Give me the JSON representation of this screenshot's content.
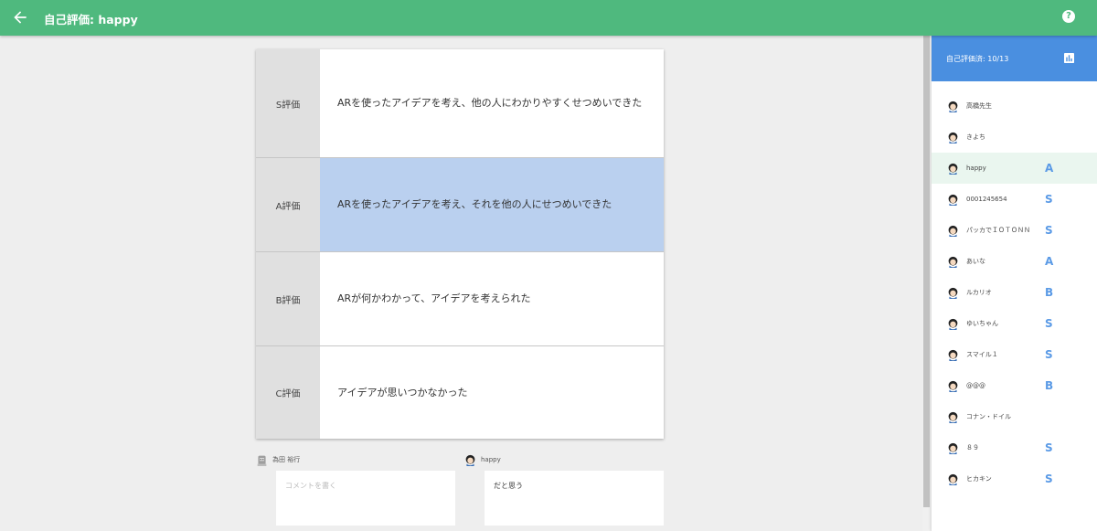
{
  "header": {
    "title": "自己評価: happy",
    "back_icon": "arrow-left-icon",
    "help_icon": "help-circle-icon",
    "color": "#4fb97e"
  },
  "rubric": {
    "rows": [
      {
        "grade": "S評価",
        "description": "ARを使ったアイデアを考え、他の人にわかりやすくせつめいできた",
        "selected": false
      },
      {
        "grade": "A評価",
        "description": "ARを使ったアイデアを考え、それを他の人にせつめいできた",
        "selected": true
      },
      {
        "grade": "B評価",
        "description": "ARが何かわかって、アイデアを考えられた",
        "selected": false
      },
      {
        "grade": "C評価",
        "description": "アイデアが思いつかなかった",
        "selected": false
      }
    ],
    "selected_color": "#bad0ef"
  },
  "comments": {
    "teacher": {
      "name": "為田 裕行",
      "placeholder": "コメントを書く"
    },
    "student": {
      "name": "happy",
      "text": "だと思う"
    }
  },
  "sidebar": {
    "title": "自己評価済: 10/13",
    "chart_icon": "bar-chart-icon",
    "color": "#4a8fe0",
    "grade_color": "#5a9ae6",
    "students": [
      {
        "name": "高橋先生",
        "grade": ""
      },
      {
        "name": "きよち",
        "grade": ""
      },
      {
        "name": "happy",
        "grade": "A",
        "active": true
      },
      {
        "name": "0001245654",
        "grade": "S"
      },
      {
        "name": "パッカでＩＯＴＯＮＮ",
        "grade": "S"
      },
      {
        "name": "あいな",
        "grade": "A"
      },
      {
        "name": "ルカリオ",
        "grade": "B"
      },
      {
        "name": "ゆいちゃん",
        "grade": "S"
      },
      {
        "name": "スマイル１",
        "grade": "S"
      },
      {
        "name": "@@@",
        "grade": "B"
      },
      {
        "name": "コナン・ドイル",
        "grade": ""
      },
      {
        "name": "８９",
        "grade": "S"
      },
      {
        "name": "ヒカキン",
        "grade": "S"
      }
    ]
  }
}
